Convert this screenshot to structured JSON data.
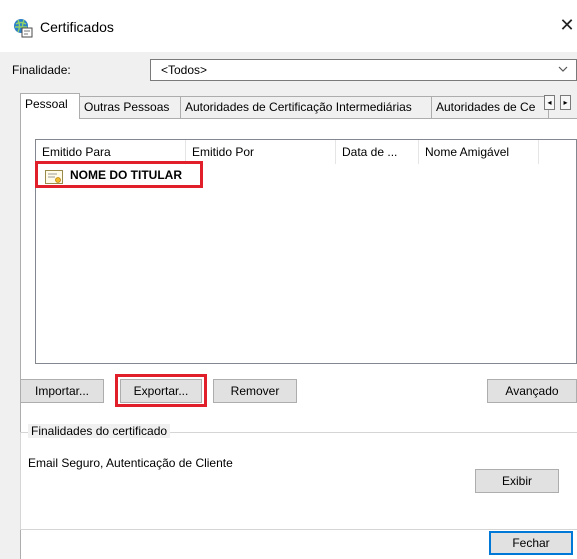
{
  "window": {
    "title": "Certificados"
  },
  "purpose": {
    "label": "Finalidade:",
    "selected": "<Todos>"
  },
  "tabs": [
    {
      "label": "Pessoal"
    },
    {
      "label": "Outras Pessoas"
    },
    {
      "label": "Autoridades de Certificação Intermediárias"
    },
    {
      "label": "Autoridades de Ce"
    }
  ],
  "list": {
    "columns": [
      "Emitido Para",
      "Emitido Por",
      "Data de ...",
      "Nome Amigável"
    ],
    "rows": [
      {
        "issued_to": "NOME DO TITULAR"
      }
    ]
  },
  "buttons": {
    "import": "Importar...",
    "export": "Exportar...",
    "remove": "Remover",
    "advanced": "Avançado",
    "view": "Exibir",
    "close": "Fechar"
  },
  "purposes_group": {
    "title": "Finalidades do certificado",
    "text": "Email Seguro, Autenticação de Cliente"
  },
  "colors": {
    "highlight": "#e01f2a",
    "active_tab": "#ffffff"
  },
  "icons": {
    "title": "certificate-globe-icon",
    "close": "close-icon",
    "row": "certificate-icon",
    "dropdown": "chevron-down-icon"
  }
}
